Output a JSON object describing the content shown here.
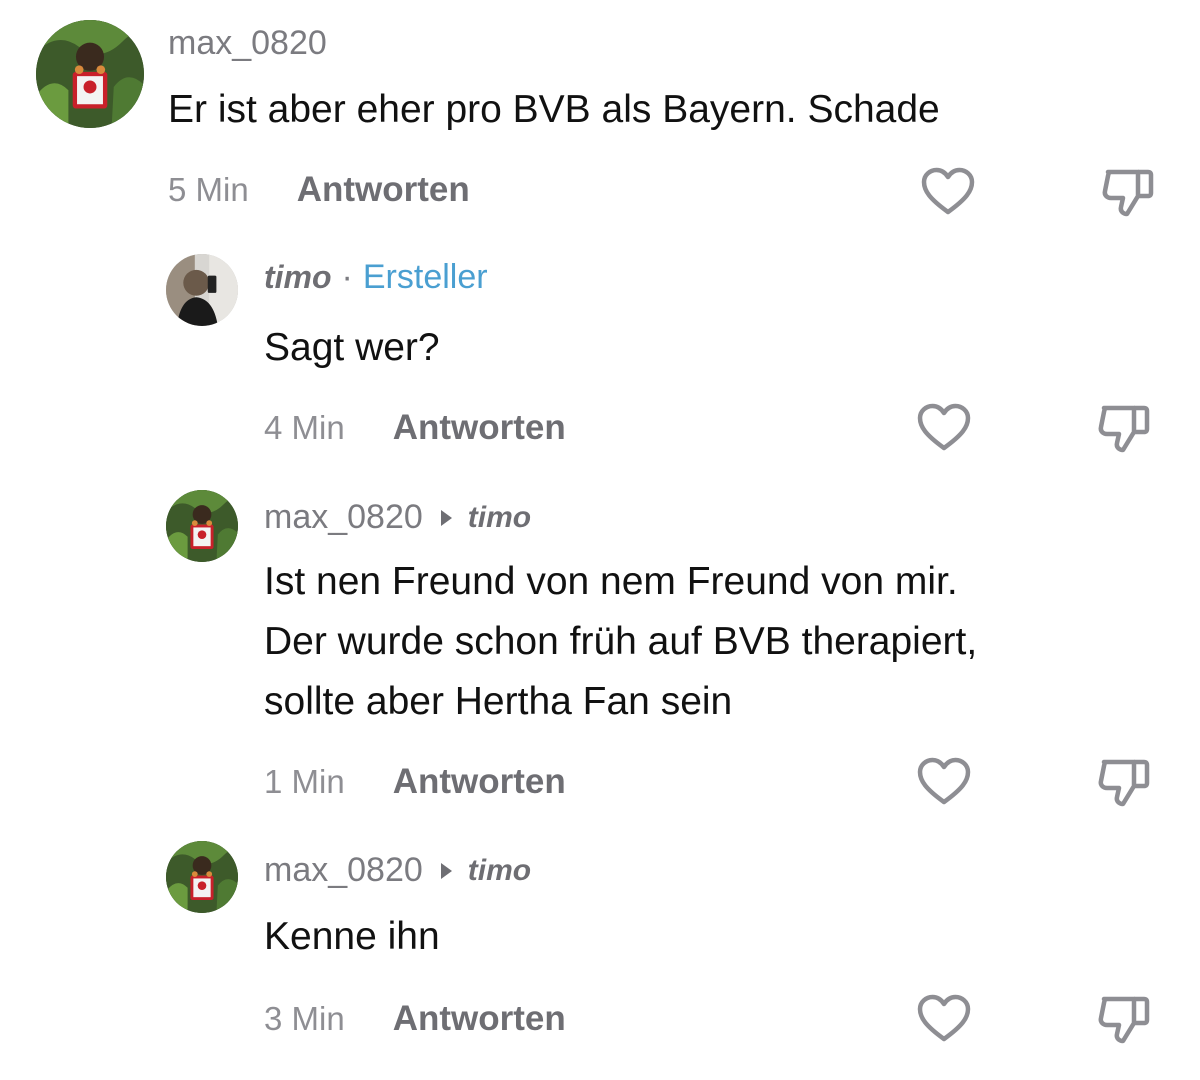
{
  "comments": [
    {
      "username": "max_0820",
      "text": "Er ist aber eher pro BVB als Bayern. Schade",
      "time": "5 Min",
      "reply_label": "Antworten"
    },
    {
      "username": "timo",
      "separator": "·",
      "badge": "Ersteller",
      "text": "Sagt wer?",
      "time": "4 Min",
      "reply_label": "Antworten"
    },
    {
      "username": "max_0820",
      "reply_to": "timo",
      "lines": [
        "Ist nen Freund von nem Freund von mir.",
        "Der wurde schon früh auf BVB therapiert,",
        "sollte aber Hertha Fan sein"
      ],
      "time": "1 Min",
      "reply_label": "Antworten"
    },
    {
      "username": "max_0820",
      "reply_to": "timo",
      "text": "Kenne ihn",
      "time": "3 Min",
      "reply_label": "Antworten"
    }
  ],
  "icons": {
    "like": "heart-outline-icon",
    "dislike": "thumbs-down-icon"
  },
  "colors": {
    "creator_badge": "#4a9fd1",
    "text": "#111111",
    "muted": "#7b7b80"
  }
}
